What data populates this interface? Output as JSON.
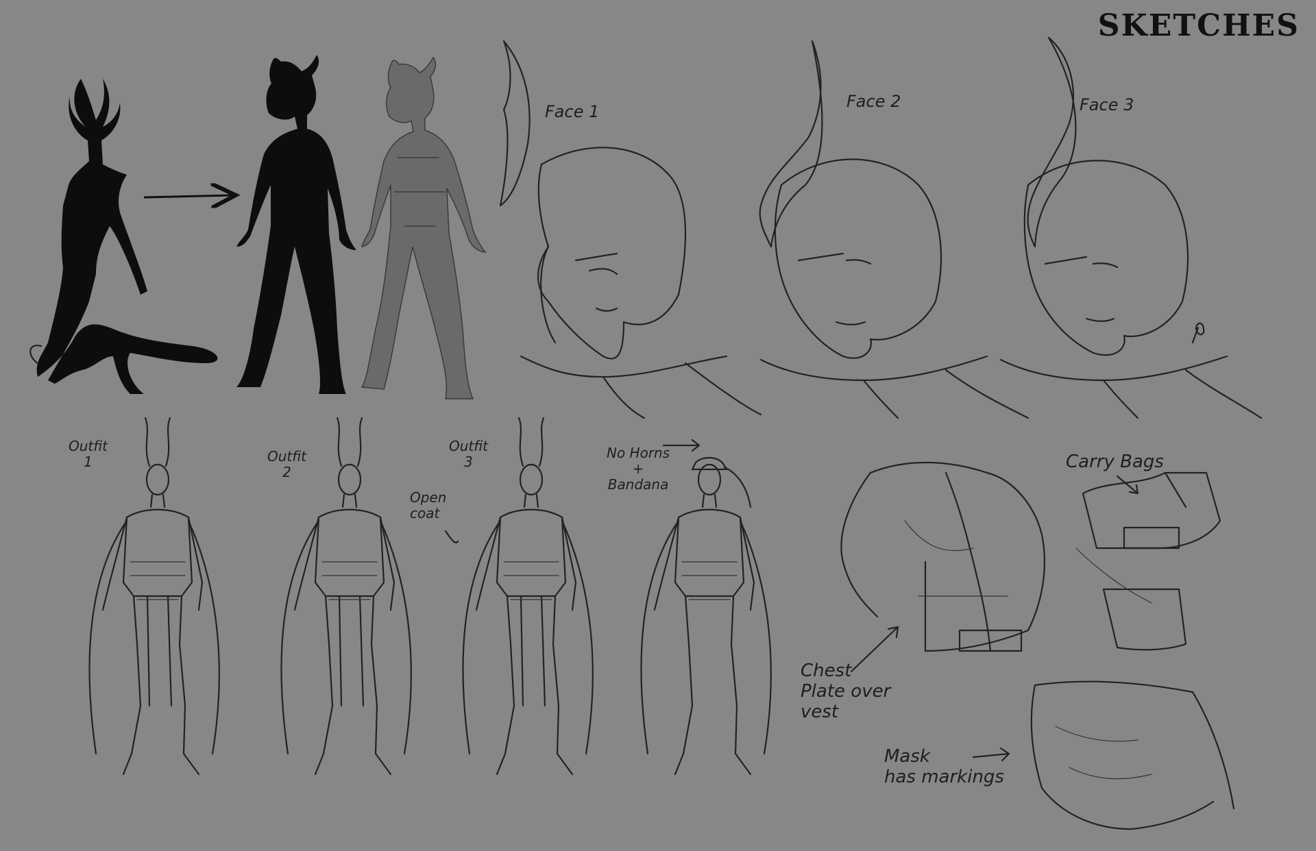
{
  "title": "SKETCHES",
  "faces": [
    {
      "label": "Face 1"
    },
    {
      "label": "Face 2"
    },
    {
      "label": "Face 3"
    }
  ],
  "outfits": [
    {
      "label": "Outfit\n1"
    },
    {
      "label": "Outfit\n2"
    },
    {
      "label": "Outfit\n3"
    }
  ],
  "notes": {
    "open_coat": "Open\ncoat",
    "no_horns": "No Horns\n+\nBandana",
    "carry_bags": "Carry Bags",
    "chest_plate": "Chest\nPlate over\nvest",
    "mask": "Mask\nhas markings"
  },
  "colors": {
    "background": "#878787",
    "ink": "#1e1e1e",
    "silhouette": "#0d0d0d"
  }
}
